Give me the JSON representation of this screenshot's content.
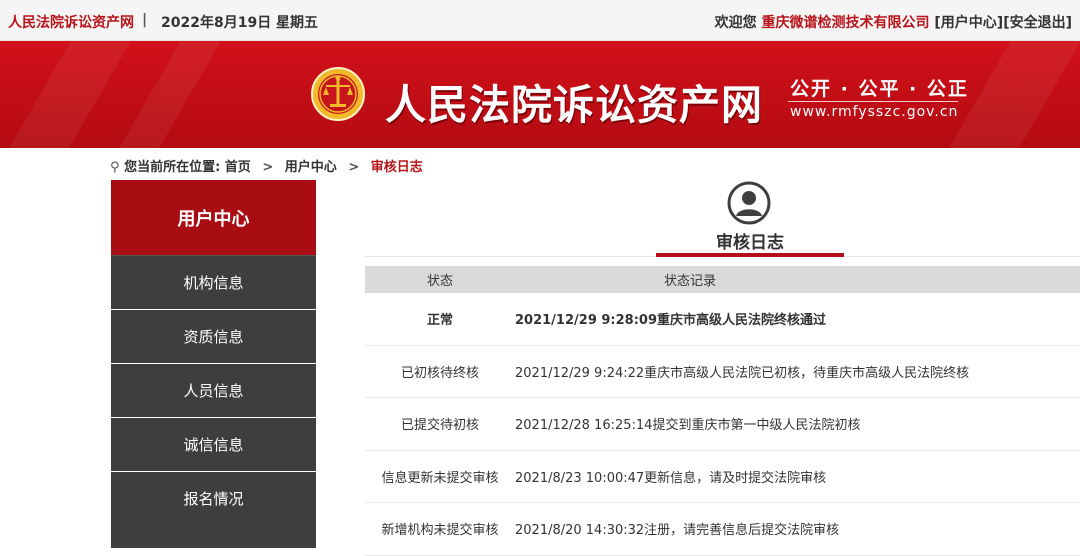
{
  "topbar": {
    "site_name": "人民法院诉讼资产网",
    "separator": "|",
    "date": "2022年8月19日  星期五",
    "welcome": "欢迎您",
    "company": "重庆微谱检测技术有限公司",
    "user_center_link": "[用户中心]",
    "logout_link": "[安全退出]"
  },
  "banner": {
    "title": "人民法院诉讼资产网",
    "motto": "公开 · 公平 · 公正",
    "url": "www.rmfysszc.gov.cn",
    "colors": {
      "primary": "#c40f17",
      "dark": "#a90d14"
    }
  },
  "breadcrumb": {
    "prefix": "您当前所在位置:",
    "items": [
      "首页",
      "用户中心",
      "审核日志"
    ],
    "arrow": ">"
  },
  "sidebar": {
    "header": "用户中心",
    "items": [
      {
        "label": "机构信息"
      },
      {
        "label": "资质信息"
      },
      {
        "label": "人员信息"
      },
      {
        "label": "诚信信息"
      },
      {
        "label": "报名情况"
      }
    ]
  },
  "main": {
    "title": "审核日志",
    "icon": "user-avatar-icon"
  },
  "table": {
    "headers": [
      "状态",
      "状态记录"
    ],
    "rows": [
      {
        "status": "正常",
        "record": "2021/12/29 9:28:09重庆市高级人民法院终核通过",
        "bold": true
      },
      {
        "status": "已初核待终核",
        "record": "2021/12/29 9:24:22重庆市高级人民法院已初核，待重庆市高级人民法院终核",
        "bold": false
      },
      {
        "status": "已提交待初核",
        "record": "2021/12/28 16:25:14提交到重庆市第一中级人民法院初核",
        "bold": false
      },
      {
        "status": "信息更新未提交审核",
        "record": "2021/8/23 10:00:47更新信息，请及时提交法院审核",
        "bold": false
      },
      {
        "status": "新增机构未提交审核",
        "record": "2021/8/20 14:30:32注册，请完善信息后提交法院审核",
        "bold": false
      }
    ]
  }
}
